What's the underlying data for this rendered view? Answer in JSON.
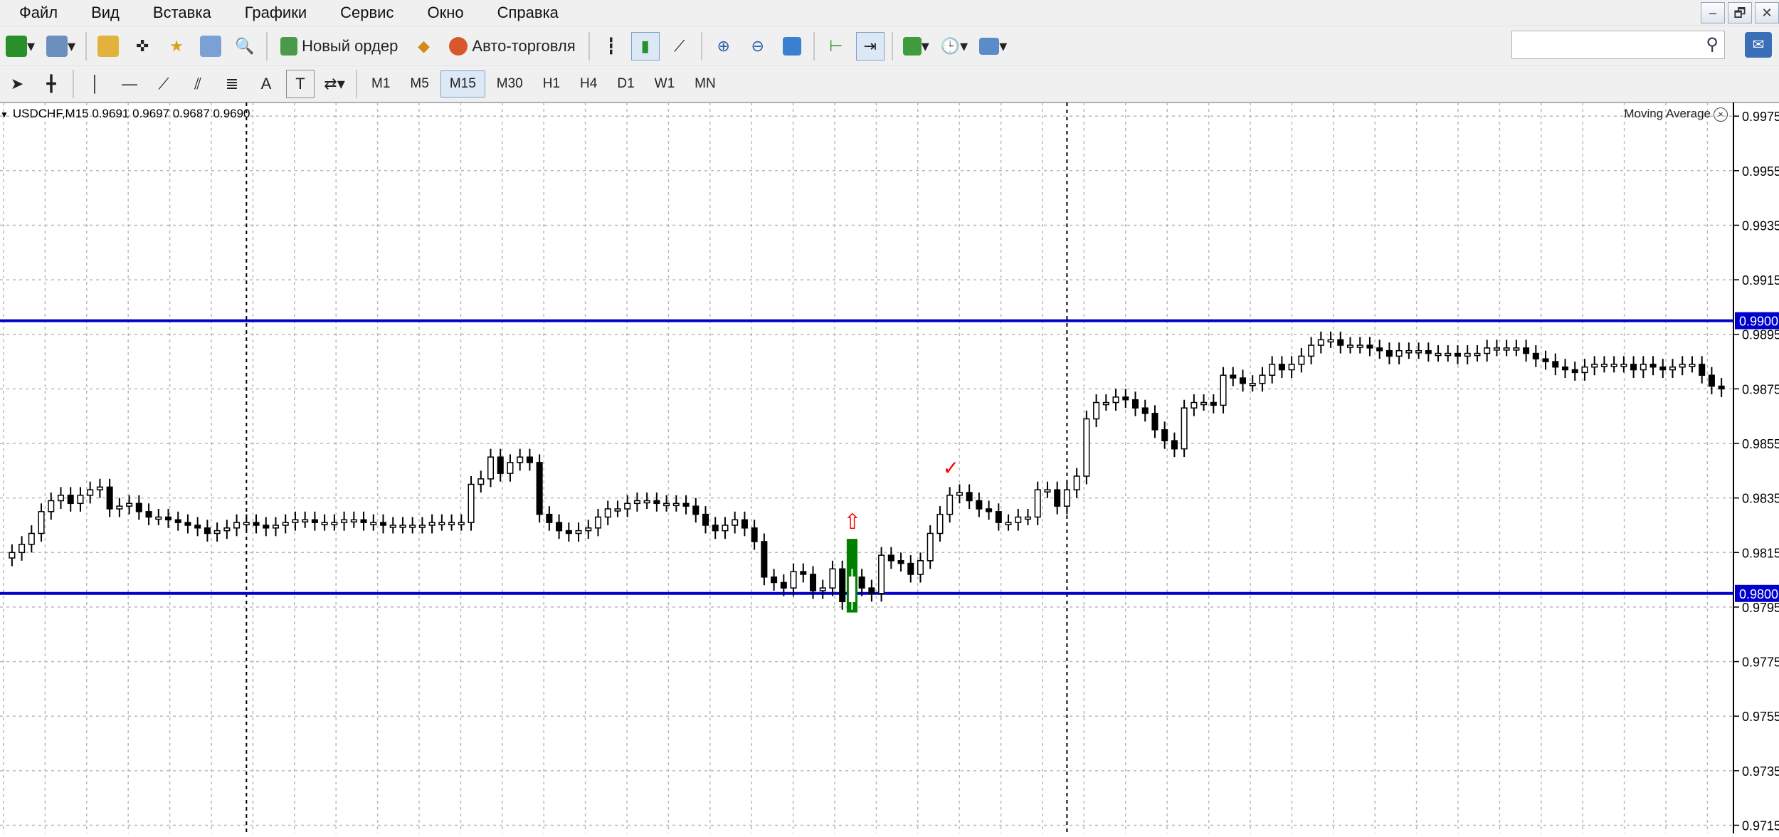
{
  "menu": [
    "Файл",
    "Вид",
    "Вставка",
    "Графики",
    "Сервис",
    "Окно",
    "Справка"
  ],
  "window_controls": [
    "–",
    "🗗",
    "✕"
  ],
  "toolbar1": {
    "new_order_label": "Новый ордер",
    "auto_trading_label": "Авто-торговля"
  },
  "timeframes": [
    "M1",
    "M5",
    "M15",
    "M30",
    "H1",
    "H4",
    "D1",
    "W1",
    "MN"
  ],
  "active_timeframe": "M15",
  "drawing_tools": {
    "text_tool_label": "A",
    "text_label_tool": "T"
  },
  "search": {
    "placeholder": ""
  },
  "chart_title": "USDCHF,M15  0.9691 0.9697 0.9687 0.9690",
  "indicator_label": "Moving Average",
  "colors": {
    "hline": "#0000cc",
    "bull": "#ffffff",
    "bear": "#000000",
    "highlight": "#008000",
    "signal": "#ff0000"
  },
  "chart_data": {
    "type": "candlestick",
    "symbol": "USDCHF",
    "timeframe": "M15",
    "ylim": [
      0.9712,
      0.998
    ],
    "yticks": [
      0.9975,
      0.9955,
      0.9935,
      0.9915,
      0.9895,
      0.9875,
      0.9855,
      0.9835,
      0.9815,
      0.9795,
      0.9775,
      0.9755,
      0.9735,
      0.9715
    ],
    "ytick_labels": [
      "0.9975",
      "0.9955",
      "0.9935",
      "0.9915",
      "0.9895",
      "0.9875",
      "0.9855",
      "0.9835",
      "0.9815",
      "0.9795",
      "0.9775",
      "0.9755",
      "0.9735",
      "0.9715"
    ],
    "horizontal_lines": [
      {
        "price": 0.99,
        "label": "0.9900"
      },
      {
        "price": 0.98,
        "label": "0.9800"
      }
    ],
    "candle_count": 120,
    "closes": [
      0.9815,
      0.9818,
      0.9822,
      0.983,
      0.9834,
      0.9836,
      0.9833,
      0.9836,
      0.9838,
      0.9839,
      0.9831,
      0.9832,
      0.9833,
      0.983,
      0.9828,
      0.9828,
      0.9827,
      0.9826,
      0.9825,
      0.9824,
      0.9822,
      0.9823,
      0.9824,
      0.9826,
      0.9826,
      0.9825,
      0.9824,
      0.9825,
      0.9826,
      0.9827,
      0.9827,
      0.9826,
      0.9826,
      0.9826,
      0.9827,
      0.9827,
      0.9826,
      0.9826,
      0.9825,
      0.9825,
      0.9825,
      0.9825,
      0.9825,
      0.9826,
      0.9826,
      0.9826,
      0.9826,
      0.984,
      0.9842,
      0.985,
      0.9844,
      0.9848,
      0.985,
      0.9848,
      0.9829,
      0.9826,
      0.9823,
      0.9822,
      0.9823,
      0.9824,
      0.9828,
      0.9831,
      0.9831,
      0.9833,
      0.9834,
      0.9834,
      0.9833,
      0.9833,
      0.9833,
      0.9832,
      0.9829,
      0.9825,
      0.9823,
      0.9825,
      0.9827,
      0.9824,
      0.9819,
      0.9806,
      0.9804,
      0.9802,
      0.9808,
      0.9807,
      0.9801,
      0.9802,
      0.9809,
      0.9797,
      0.9806,
      0.9802,
      0.98,
      0.9814,
      0.9812,
      0.9811,
      0.9807,
      0.9812,
      0.9822,
      0.9829,
      0.9836,
      0.9837,
      0.9834,
      0.9831,
      0.983,
      0.9826,
      0.9826,
      0.9828,
      0.9828,
      0.9838,
      0.9838,
      0.9832,
      0.9838,
      0.9843,
      0.9864,
      0.987,
      0.987,
      0.9872,
      0.9871,
      0.9868,
      0.9866,
      0.986,
      0.9856,
      0.9853,
      0.9868,
      0.987,
      0.987,
      0.9869,
      0.988,
      0.9879,
      0.9877,
      0.9877,
      0.988,
      0.9884,
      0.9882,
      0.9884,
      0.9887,
      0.9891,
      0.9893,
      0.9893,
      0.9891,
      0.9891,
      0.9891,
      0.989,
      0.9889,
      0.9887,
      0.9889,
      0.9889,
      0.9889,
      0.9888,
      0.9888,
      0.9888,
      0.9887,
      0.9888,
      0.9888,
      0.989,
      0.989,
      0.989,
      0.989,
      0.9888,
      0.9886,
      0.9885,
      0.9883,
      0.9882,
      0.9881,
      0.9883,
      0.9884,
      0.9884,
      0.9884,
      0.9884,
      0.9882,
      0.9884,
      0.9883,
      0.9882,
      0.9883,
      0.9884,
      0.9884,
      0.988,
      0.9876,
      0.9875
    ],
    "highlight_candle_index": 86,
    "annotations": [
      {
        "type": "up-arrow",
        "index": 86,
        "price": 0.982
      },
      {
        "type": "checkmark",
        "index": 96,
        "price": 0.9842
      }
    ],
    "vertical_separators_index": [
      24,
      108
    ]
  }
}
